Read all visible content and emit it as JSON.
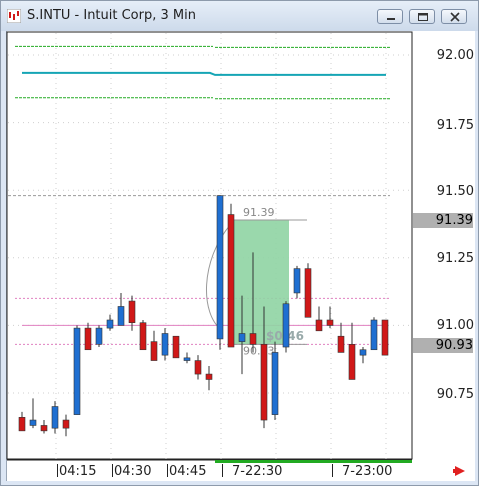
{
  "window": {
    "title": "S.INTU - Intuit Corp, 3 Min",
    "buttons": [
      "minimize",
      "maximize",
      "close"
    ]
  },
  "price_axis": {
    "labels": [
      "92.00",
      "91.75",
      "91.50",
      "91.25",
      "91.00",
      "90.75"
    ],
    "highlighted": [
      "91.39",
      "90.93"
    ]
  },
  "time_axis": {
    "labels": [
      "04:15",
      "04:30",
      "04:45",
      "7-22:30",
      "7-23:00"
    ]
  },
  "overlay": {
    "top_price": "91.39",
    "bottom_price": "90.93",
    "change": "$0.46"
  },
  "colors": {
    "up": "#1f6fd1",
    "down": "#d01818",
    "green_line": "#22aa22",
    "teal_line": "#15a5b5",
    "pink_line": "#e080c0",
    "gray_line": "#999999",
    "selection_fill": "#8fd4a3",
    "arrow": "#e02020"
  },
  "chart_data": {
    "type": "candlestick",
    "y_range": [
      90.6,
      92.1
    ],
    "candles": [
      {
        "o": 90.66,
        "h": 90.68,
        "l": 90.61,
        "c": 90.61
      },
      {
        "o": 90.63,
        "h": 90.73,
        "l": 90.62,
        "c": 90.65
      },
      {
        "o": 90.63,
        "h": 90.65,
        "l": 90.6,
        "c": 90.61
      },
      {
        "o": 90.62,
        "h": 90.72,
        "l": 90.6,
        "c": 90.7
      },
      {
        "o": 90.65,
        "h": 90.67,
        "l": 90.59,
        "c": 90.62
      },
      {
        "o": 90.67,
        "h": 91.0,
        "l": 90.67,
        "c": 90.99
      },
      {
        "o": 90.99,
        "h": 91.01,
        "l": 90.91,
        "c": 90.91
      },
      {
        "o": 90.93,
        "h": 91.0,
        "l": 90.92,
        "c": 90.99
      },
      {
        "o": 90.99,
        "h": 91.04,
        "l": 90.98,
        "c": 91.02
      },
      {
        "o": 91.0,
        "h": 91.12,
        "l": 91.0,
        "c": 91.07
      },
      {
        "o": 91.09,
        "h": 91.11,
        "l": 90.98,
        "c": 91.01
      },
      {
        "o": 91.01,
        "h": 91.02,
        "l": 90.91,
        "c": 90.91
      },
      {
        "o": 90.94,
        "h": 90.98,
        "l": 90.87,
        "c": 90.87
      },
      {
        "o": 90.89,
        "h": 90.99,
        "l": 90.87,
        "c": 90.97
      },
      {
        "o": 90.96,
        "h": 90.96,
        "l": 90.88,
        "c": 90.88
      },
      {
        "o": 90.87,
        "h": 90.9,
        "l": 90.86,
        "c": 90.88
      },
      {
        "o": 90.87,
        "h": 90.89,
        "l": 90.8,
        "c": 90.82
      },
      {
        "o": 90.82,
        "h": 90.85,
        "l": 90.76,
        "c": 90.8
      },
      {
        "o": 90.95,
        "h": 91.48,
        "l": 90.91,
        "c": 91.48
      },
      {
        "o": 91.41,
        "h": 91.45,
        "l": 90.92,
        "c": 90.92
      },
      {
        "o": 90.94,
        "h": 91.11,
        "l": 90.82,
        "c": 90.97
      },
      {
        "o": 90.97,
        "h": 91.27,
        "l": 90.9,
        "c": 90.93
      },
      {
        "o": 90.93,
        "h": 91.07,
        "l": 90.62,
        "c": 90.65
      },
      {
        "o": 90.67,
        "h": 90.94,
        "l": 90.65,
        "c": 90.9
      },
      {
        "o": 90.92,
        "h": 91.09,
        "l": 90.9,
        "c": 91.08
      },
      {
        "o": 91.12,
        "h": 91.22,
        "l": 91.1,
        "c": 91.21
      },
      {
        "o": 91.21,
        "h": 91.23,
        "l": 91.03,
        "c": 91.03
      },
      {
        "o": 91.02,
        "h": 91.07,
        "l": 90.98,
        "c": 90.98
      },
      {
        "o": 91.02,
        "h": 91.07,
        "l": 90.99,
        "c": 91.0
      },
      {
        "o": 90.96,
        "h": 91.01,
        "l": 90.9,
        "c": 90.9
      },
      {
        "o": 90.93,
        "h": 91.01,
        "l": 90.8,
        "c": 90.8
      },
      {
        "o": 90.89,
        "h": 90.92,
        "l": 90.86,
        "c": 90.91
      },
      {
        "o": 90.91,
        "h": 91.03,
        "l": 90.91,
        "c": 91.02
      },
      {
        "o": 91.02,
        "h": 91.02,
        "l": 90.89,
        "c": 90.89
      }
    ],
    "levels": [
      {
        "kind": "green_dashed",
        "price": 92.03
      },
      {
        "kind": "teal",
        "price": 91.93
      },
      {
        "kind": "green_dashed",
        "price": 91.84
      },
      {
        "kind": "gray_dashed",
        "price": 91.48
      },
      {
        "kind": "pink_dotted",
        "price": 91.1
      },
      {
        "kind": "pink_solid",
        "price": 91.0
      },
      {
        "kind": "pink_dotted",
        "price": 90.93
      }
    ]
  }
}
